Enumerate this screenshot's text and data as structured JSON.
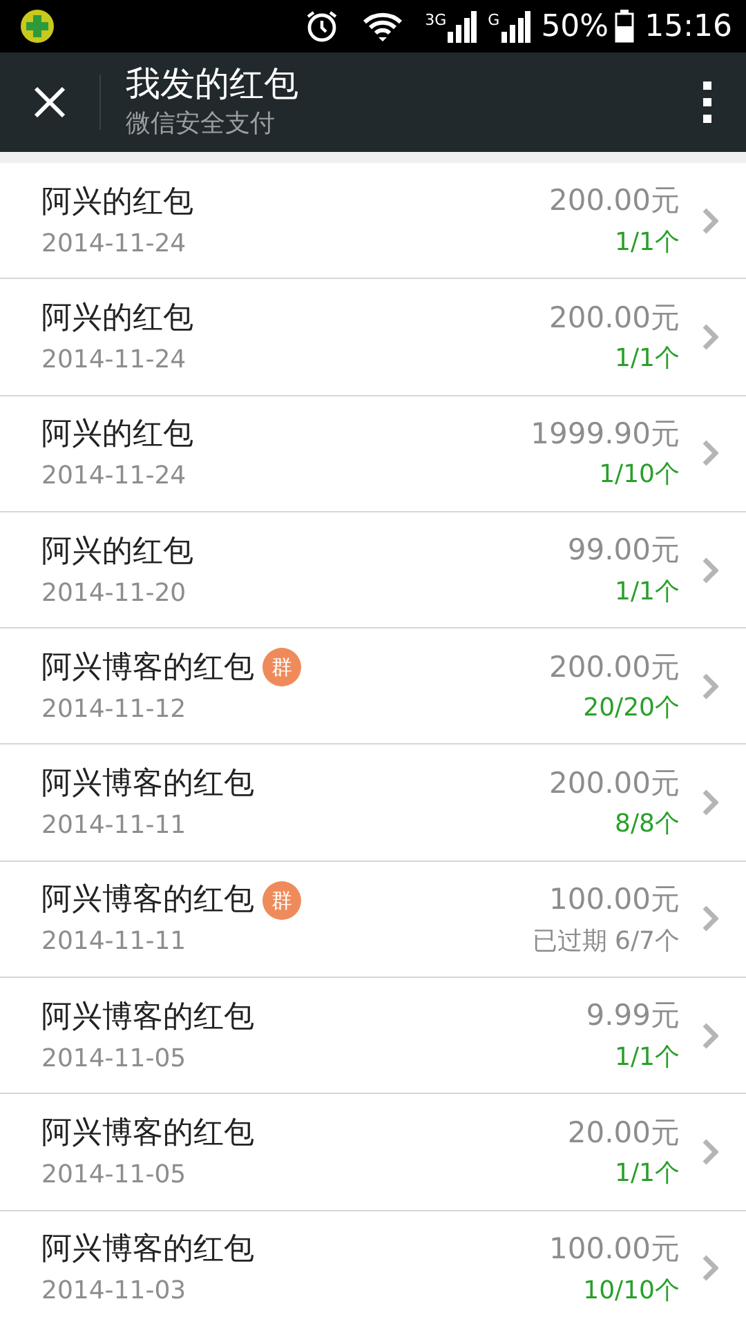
{
  "status_bar": {
    "battery": "50%",
    "time": "15:16",
    "network_1": "3G",
    "network_2": "G"
  },
  "app_bar": {
    "title": "我发的红包",
    "subtitle": "微信安全支付"
  },
  "items": [
    {
      "title": "阿兴的红包",
      "date": "2014-11-24",
      "amount": "200.00元",
      "count": "1/1个",
      "expired": false
    },
    {
      "title": "阿兴的红包",
      "date": "2014-11-24",
      "amount": "200.00元",
      "count": "1/1个",
      "expired": false
    },
    {
      "title": "阿兴的红包",
      "date": "2014-11-24",
      "amount": "1999.90元",
      "count": "1/10个",
      "expired": false
    },
    {
      "title": "阿兴的红包",
      "date": "2014-11-20",
      "amount": "99.00元",
      "count": "1/1个",
      "expired": false
    },
    {
      "title": "阿兴博客的红包",
      "badge": "群",
      "date": "2014-11-12",
      "amount": "200.00元",
      "count": "20/20个",
      "expired": false
    },
    {
      "title": "阿兴博客的红包",
      "date": "2014-11-11",
      "amount": "200.00元",
      "count": "8/8个",
      "expired": false
    },
    {
      "title": "阿兴博客的红包",
      "badge": "群",
      "date": "2014-11-11",
      "amount": "100.00元",
      "count": "已过期 6/7个",
      "expired": true
    },
    {
      "title": "阿兴博客的红包",
      "date": "2014-11-05",
      "amount": "9.99元",
      "count": "1/1个",
      "expired": false
    },
    {
      "title": "阿兴博客的红包",
      "date": "2014-11-05",
      "amount": "20.00元",
      "count": "1/1个",
      "expired": false
    },
    {
      "title": "阿兴博客的红包",
      "date": "2014-11-03",
      "amount": "100.00元",
      "count": "10/10个",
      "expired": false
    }
  ]
}
